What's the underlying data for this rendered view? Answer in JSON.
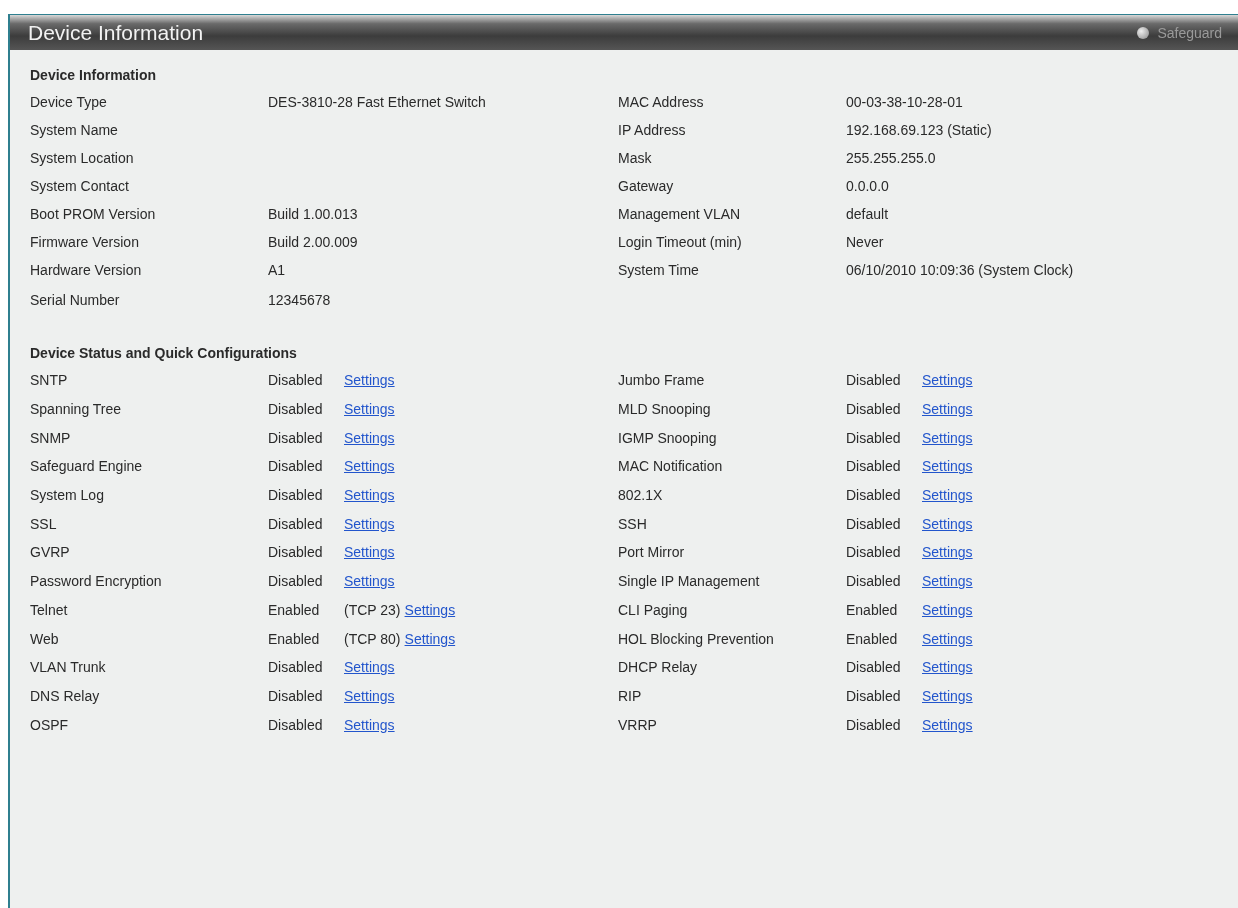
{
  "window": {
    "title": "Device Information",
    "safeguard": {
      "label": "Safeguard"
    }
  },
  "device_info": {
    "heading": "Device Information",
    "left": [
      {
        "label": "Device Type",
        "value": "DES-3810-28 Fast Ethernet Switch"
      },
      {
        "label": "System Name"
      },
      {
        "label": "System Location"
      },
      {
        "label": "System Contact"
      },
      {
        "label": "Boot PROM Version",
        "value": "Build 1.00.013"
      },
      {
        "label": "Firmware Version",
        "value": "Build 2.00.009"
      },
      {
        "label": "Hardware Version",
        "value": "A1"
      },
      {
        "label": "Serial Number",
        "value": "12345678"
      }
    ],
    "right": [
      {
        "label": "MAC Address",
        "value": "00-03-38-10-28-01"
      },
      {
        "label": "IP Address",
        "value": "192.168.69.123 (Static)"
      },
      {
        "label": "Mask",
        "value": "255.255.255.0"
      },
      {
        "label": "Gateway",
        "value": "0.0.0.0"
      },
      {
        "label": "Management VLAN",
        "value": "default"
      },
      {
        "label": "Login Timeout (min)",
        "value": "Never"
      },
      {
        "label": "System Time",
        "value": "06/10/2010 10:09:36 (System Clock)"
      }
    ]
  },
  "quick_config": {
    "heading": "Device Status and Quick Configurations",
    "left": [
      {
        "label": "SNTP",
        "status": "Disabled",
        "link": "Settings"
      },
      {
        "label": "Spanning Tree",
        "status": "Disabled",
        "link": "Settings"
      },
      {
        "label": "SNMP",
        "status": "Disabled",
        "link": "Settings"
      },
      {
        "label": "Safeguard Engine",
        "status": "Disabled",
        "link": "Settings"
      },
      {
        "label": "System Log",
        "status": "Disabled",
        "link": "Settings"
      },
      {
        "label": "SSL",
        "status": "Disabled",
        "link": "Settings"
      },
      {
        "label": "GVRP",
        "status": "Disabled",
        "link": "Settings"
      },
      {
        "label": "Password Encryption",
        "status": "Disabled",
        "link": "Settings"
      },
      {
        "label": "Telnet",
        "status": "Enabled",
        "port": "(TCP 23)",
        "link": "Settings"
      },
      {
        "label": "Web",
        "status": "Enabled",
        "port": "(TCP 80)",
        "link": "Settings"
      },
      {
        "label": "VLAN Trunk",
        "status": "Disabled",
        "link": "Settings"
      },
      {
        "label": "DNS Relay",
        "status": "Disabled",
        "link": "Settings"
      },
      {
        "label": "OSPF",
        "status": "Disabled",
        "link": "Settings"
      }
    ],
    "right": [
      {
        "label": "Jumbo Frame",
        "status": "Disabled",
        "link": "Settings"
      },
      {
        "label": "MLD Snooping",
        "status": "Disabled",
        "link": "Settings"
      },
      {
        "label": "IGMP Snooping",
        "status": "Disabled",
        "link": "Settings"
      },
      {
        "label": "MAC Notification",
        "status": "Disabled",
        "link": "Settings"
      },
      {
        "label": "802.1X",
        "status": "Disabled",
        "link": "Settings"
      },
      {
        "label": "SSH",
        "status": "Disabled",
        "link": "Settings"
      },
      {
        "label": "Port Mirror",
        "status": "Disabled",
        "link": "Settings"
      },
      {
        "label": "Single IP Management",
        "status": "Disabled",
        "link": "Settings"
      },
      {
        "label": "CLI Paging",
        "status": "Enabled",
        "link": "Settings"
      },
      {
        "label": "HOL Blocking Prevention",
        "status": "Enabled",
        "link": "Settings"
      },
      {
        "label": "DHCP Relay",
        "status": "Disabled",
        "link": "Settings"
      },
      {
        "label": "RIP",
        "status": "Disabled",
        "link": "Settings"
      },
      {
        "label": "VRRP",
        "status": "Disabled",
        "link": "Settings"
      }
    ]
  }
}
